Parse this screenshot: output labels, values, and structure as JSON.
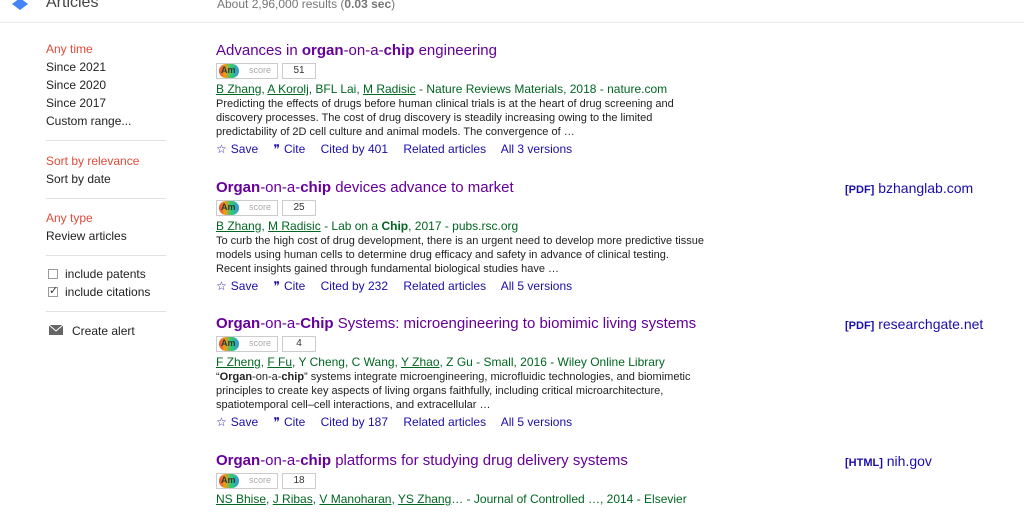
{
  "header": {
    "section_title": "Articles",
    "results_count_prefix": "About 2,96,000 results (",
    "results_time": "0.03 sec",
    "results_count_suffix": ")"
  },
  "sidebar": {
    "time_filters": [
      "Any time",
      "Since 2021",
      "Since 2020",
      "Since 2017",
      "Custom range..."
    ],
    "sort_filters": [
      "Sort by relevance",
      "Sort by date"
    ],
    "type_filters": [
      "Any type",
      "Review articles"
    ],
    "include_patents": "include patents",
    "include_citations": "include citations",
    "create_alert": "Create alert"
  },
  "results": [
    {
      "title_pre": "Advances in ",
      "title_bold1": "organ",
      "title_mid1": "-on-a-",
      "title_bold2": "chip",
      "title_post": " engineering",
      "am": "Am",
      "score_label": "score",
      "score": "51",
      "authors": [
        {
          "t": "B Zhang",
          "u": true
        },
        {
          "t": ", ",
          "u": false
        },
        {
          "t": "A Korolj",
          "u": true
        },
        {
          "t": ", BFL Lai, ",
          "u": false
        },
        {
          "t": "M Radisic",
          "u": true
        },
        {
          "t": " - Nature Reviews Materials, 2018 - nature.com",
          "u": false
        }
      ],
      "snippet": "Predicting the effects of drugs before human clinical trials is at the heart of drug screening and discovery processes. The cost of drug discovery is steadily increasing owing to the limited predictability of 2D cell culture and animal models. The convergence of …",
      "save": "Save",
      "cite": "Cite",
      "cited_by": "Cited by 401",
      "related": "Related articles",
      "versions": "All 3 versions",
      "side_tag": "",
      "side_link": ""
    },
    {
      "title_pre": "",
      "title_bold1": "Organ",
      "title_mid1": "-on-a-",
      "title_bold2": "chip",
      "title_post": " devices advance to market",
      "am": "Am",
      "score_label": "score",
      "score": "25",
      "authors": [
        {
          "t": "B Zhang",
          "u": true
        },
        {
          "t": ", ",
          "u": false
        },
        {
          "t": "M Radisic",
          "u": true
        },
        {
          "t": " - Lab on a ",
          "u": false
        },
        {
          "t": "Chip",
          "u": false,
          "b": true
        },
        {
          "t": ", 2017 - pubs.rsc.org",
          "u": false
        }
      ],
      "snippet": "To curb the high cost of drug development, there is an urgent need to develop more predictive tissue models using human cells to determine drug efficacy and safety in advance of clinical testing. Recent insights gained through fundamental biological studies have …",
      "save": "Save",
      "cite": "Cite",
      "cited_by": "Cited by 232",
      "related": "Related articles",
      "versions": "All 5 versions",
      "side_tag": "[PDF]",
      "side_link": "bzhanglab.com"
    },
    {
      "title_pre": "",
      "title_bold1": "Organ",
      "title_mid1": "-on-a-",
      "title_bold2": "Chip",
      "title_post": " Systems: microengineering to biomimic living systems",
      "am": "Am",
      "score_label": "score",
      "score": "4",
      "authors": [
        {
          "t": "F Zheng",
          "u": true
        },
        {
          "t": ", ",
          "u": false
        },
        {
          "t": "F Fu",
          "u": true
        },
        {
          "t": ", Y Cheng, C Wang, ",
          "u": false
        },
        {
          "t": "Y Zhao",
          "u": true
        },
        {
          "t": ", Z Gu - Small, 2016 - Wiley Online Library",
          "u": false
        }
      ],
      "snippet_b1": "Organ",
      "snippet_m1": "-on-a-",
      "snippet_b2": "chip",
      "snippet": "” systems integrate microengineering, microfluidic technologies, and biomimetic principles to create key aspects of living organs faithfully, including critical microarchitecture, spatiotemporal cell–cell interactions, and extracellular …",
      "save": "Save",
      "cite": "Cite",
      "cited_by": "Cited by 187",
      "related": "Related articles",
      "versions": "All 5 versions",
      "side_tag": "[PDF]",
      "side_link": "researchgate.net"
    },
    {
      "title_pre": "",
      "title_bold1": "Organ",
      "title_mid1": "-on-a-",
      "title_bold2": "chip",
      "title_post": " platforms for studying drug delivery systems",
      "am": "Am",
      "score_label": "score",
      "score": "18",
      "authors": [
        {
          "t": "NS Bhise",
          "u": true
        },
        {
          "t": ", ",
          "u": false
        },
        {
          "t": "J Ribas",
          "u": true
        },
        {
          "t": ", ",
          "u": false
        },
        {
          "t": "V Manoharan",
          "u": true
        },
        {
          "t": ", ",
          "u": false
        },
        {
          "t": "YS Zhang",
          "u": true
        },
        {
          "t": "… - Journal of Controlled …, 2014 - Elsevier",
          "u": false
        }
      ],
      "snippet": "",
      "save": "",
      "cite": "",
      "cited_by": "",
      "related": "",
      "versions": "",
      "side_tag": "[HTML]",
      "side_link": "nih.gov"
    }
  ]
}
